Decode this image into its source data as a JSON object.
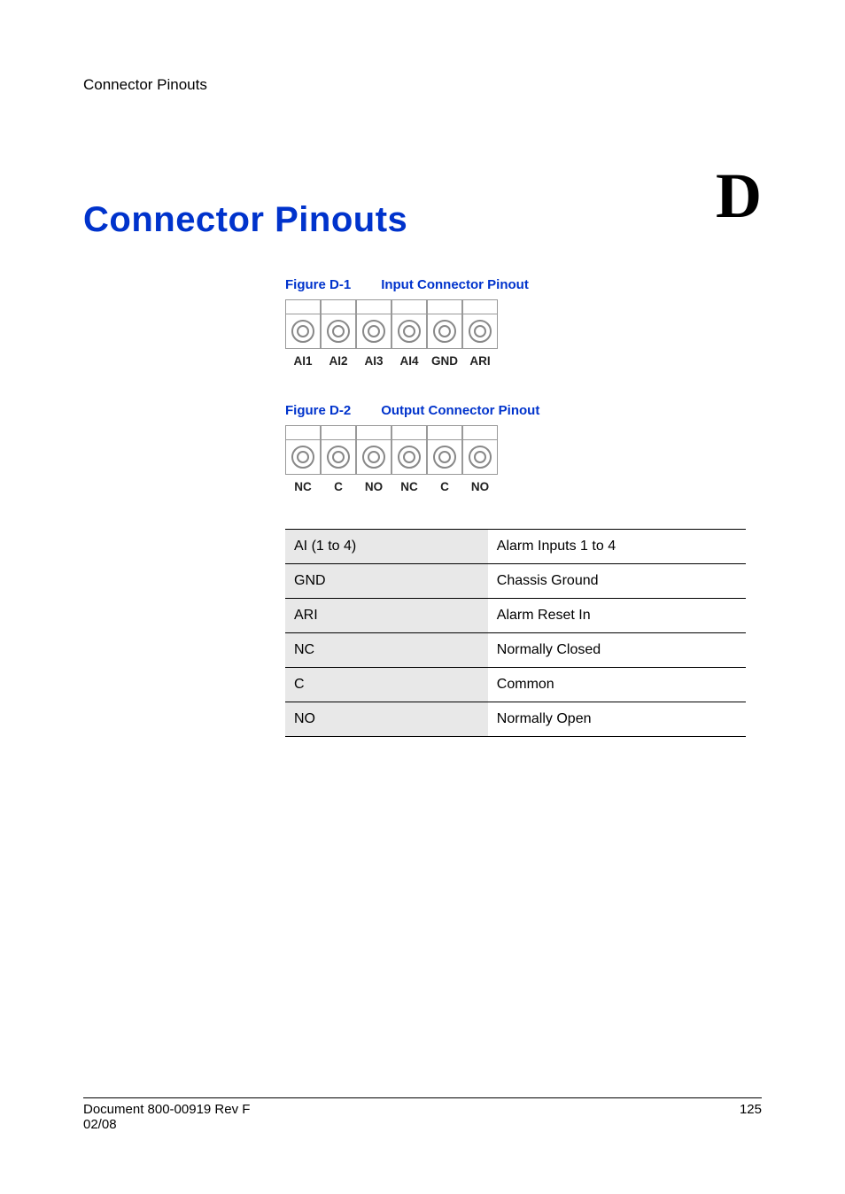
{
  "running_header": "Connector Pinouts",
  "appendix_letter": "D",
  "title": "Connector Pinouts",
  "figures": {
    "d1": {
      "prefix": "Figure D-1",
      "title": "Input Connector Pinout",
      "labels": [
        "AI1",
        "AI2",
        "AI3",
        "AI4",
        "GND",
        "ARI"
      ]
    },
    "d2": {
      "prefix": "Figure D-2",
      "title": "Output Connector Pinout",
      "labels": [
        "NC",
        "C",
        "NO",
        "NC",
        "C",
        "NO"
      ]
    }
  },
  "table": {
    "rows": [
      {
        "abbr": "AI (1 to 4)",
        "desc": "Alarm Inputs 1 to 4"
      },
      {
        "abbr": "GND",
        "desc": "Chassis Ground"
      },
      {
        "abbr": "ARI",
        "desc": "Alarm Reset In"
      },
      {
        "abbr": "NC",
        "desc": "Normally Closed"
      },
      {
        "abbr": "C",
        "desc": "Common"
      },
      {
        "abbr": "NO",
        "desc": "Normally Open"
      }
    ]
  },
  "footer": {
    "doc_line1": "Document 800-00919 Rev F",
    "doc_line2": "02/08",
    "page": "125"
  }
}
